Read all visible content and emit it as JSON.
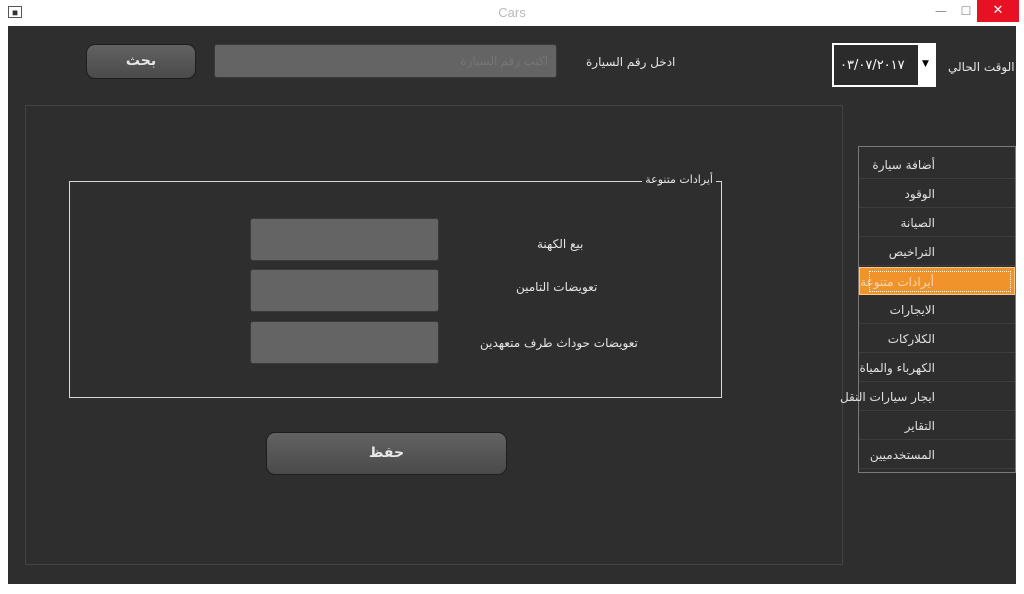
{
  "window": {
    "title": "Cars",
    "app_icon": "app-icon",
    "minimize": "—",
    "maximize": "☐",
    "close": "✕"
  },
  "header": {
    "search_button": "بحث",
    "search_placeholder": "اكتب رقم السيارة",
    "car_number_label": "ادخل رقم السيارة",
    "current_time_label": "الوقت الحالي",
    "date_value": "٠٣/٠٧/٢٠١٧",
    "dropdown_icon": "chevron-down-icon"
  },
  "group": {
    "title": "أيرادات متنوعة",
    "fields": [
      {
        "label": "بيع الكهنة",
        "value": ""
      },
      {
        "label": "تعويضات التامين",
        "value": ""
      },
      {
        "label": "تعويضات حوداث طرف متعهدين",
        "value": ""
      }
    ]
  },
  "save_button": "حفظ",
  "menu": {
    "items": [
      {
        "label": "أضافة سيارة"
      },
      {
        "label": "الوقود"
      },
      {
        "label": "الصيانة"
      },
      {
        "label": "التراخيص"
      },
      {
        "label": "أيرادات متنوعة"
      },
      {
        "label": "الايجارات"
      },
      {
        "label": "الكلاركات"
      },
      {
        "label": "الكهرباء والمياة"
      },
      {
        "label": "ايجار سيارات النقل"
      },
      {
        "label": "التقاير"
      },
      {
        "label": "المستخدميين"
      }
    ],
    "active_index": 4
  },
  "colors": {
    "window_bg": "#2e2e2e",
    "accent": "#f0932b",
    "close_red": "#e81123"
  }
}
